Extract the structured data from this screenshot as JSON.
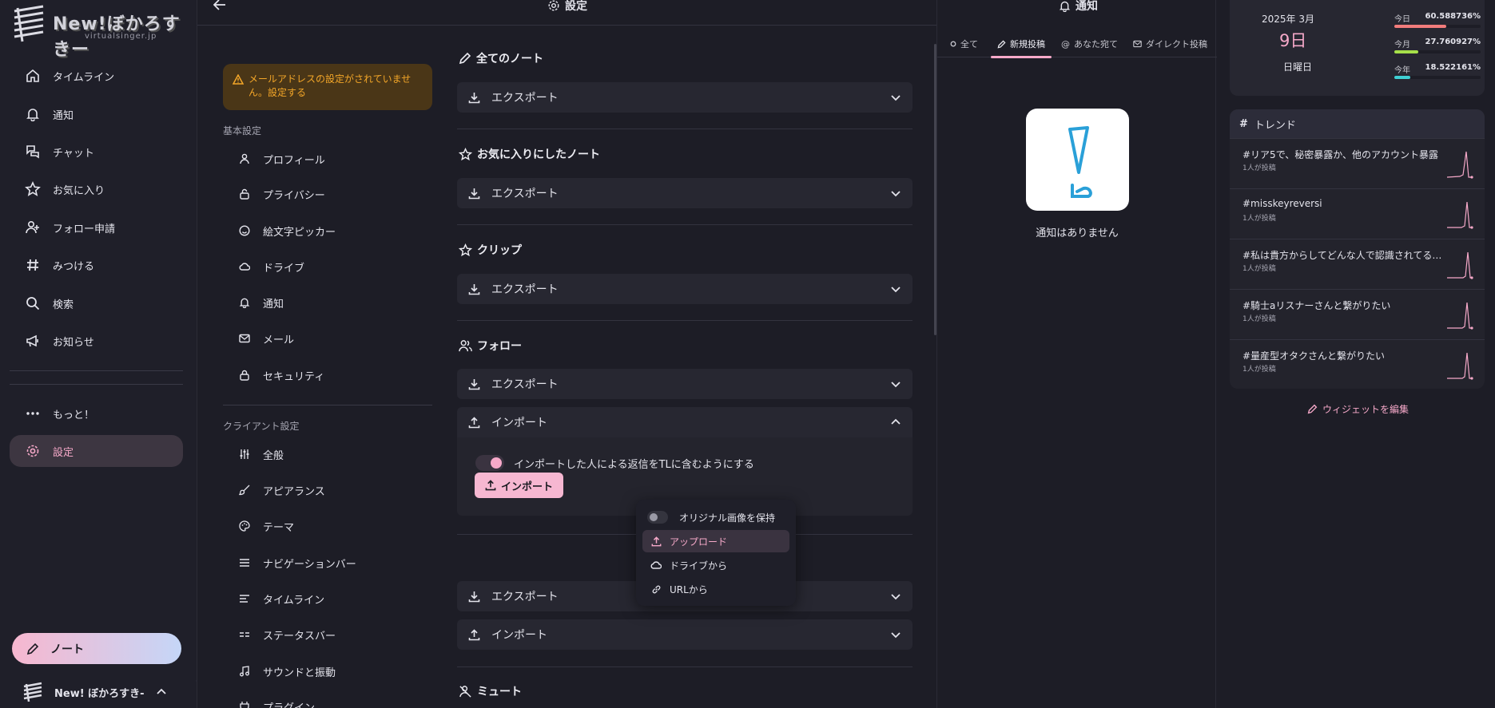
{
  "nav": {
    "logo_title": "New!ぼかろすきー",
    "logo_sub": "virtualsinger.jp",
    "items": [
      {
        "label": "タイムライン",
        "icon": "home-icon"
      },
      {
        "label": "通知",
        "icon": "bell-icon"
      },
      {
        "label": "チャット",
        "icon": "chat-icon"
      },
      {
        "label": "お気に入り",
        "icon": "star-icon"
      },
      {
        "label": "フォロー申請",
        "icon": "user-plus-icon"
      },
      {
        "label": "みつける",
        "icon": "hash-icon"
      },
      {
        "label": "検索",
        "icon": "search-icon"
      },
      {
        "label": "お知らせ",
        "icon": "megaphone-icon"
      },
      {
        "label": "もっと！",
        "icon": "dots-icon"
      },
      {
        "label": "設定",
        "icon": "gear-icon",
        "active": true
      }
    ],
    "note_button": "ノート",
    "account_name": "New! ぼかろすき-"
  },
  "settings": {
    "title": "設定",
    "warning": "メールアドレスの設定がされていません。設定する",
    "basic_label": "基本設定",
    "basic_items": [
      "プロフィール",
      "プライバシー",
      "絵文字ピッカー",
      "ドライブ",
      "通知",
      "メール",
      "セキュリティ"
    ],
    "client_label": "クライアント設定",
    "client_items": [
      "全般",
      "アピアランス",
      "テーマ",
      "ナビゲーションバー",
      "タイムライン",
      "ステータスバー",
      "サウンドと振動",
      "プラグイン"
    ],
    "groups": {
      "all_notes": "全てのノート",
      "favorites": "お気に入りにしたノート",
      "clips": "クリップ",
      "follow": "フォロー",
      "mute": "ミュート"
    },
    "export_label": "エクスポート",
    "import_label": "インポート",
    "toggle_label": "インポートした人による返信をTLに含むようにする",
    "import_button": "インポート"
  },
  "popup": {
    "keep_original": "オリジナル画像を保持",
    "upload": "アップロード",
    "from_drive": "ドライブから",
    "from_url": "URLから"
  },
  "notifications": {
    "title": "通知",
    "tabs": [
      "全て",
      "新規投稿",
      "あなた宛て",
      "ダイレクト投稿"
    ],
    "active_tab": "新規投稿",
    "empty": "通知はありません"
  },
  "calendar": {
    "year_month": "2025年  3月",
    "day": "9日",
    "weekday": "日曜日",
    "stats": [
      {
        "label": "今日",
        "value": "60.588736%",
        "fraction": 0.606,
        "color": "#f27c7c"
      },
      {
        "label": "今月",
        "value": "27.760927%",
        "fraction": 0.278,
        "color": "#a6e04a"
      },
      {
        "label": "今年",
        "value": "18.522161%",
        "fraction": 0.185,
        "color": "#3fd0d4"
      }
    ]
  },
  "trends": {
    "title": "トレンド",
    "items": [
      {
        "tag": "#リア5で、秘密暴露か、他のアカウント暴露",
        "count": "1人が投稿"
      },
      {
        "tag": "#misskeyreversi",
        "count": "1人が投稿"
      },
      {
        "tag": "#私は貴方からしてどんな人で認識されてるのか知りたい",
        "count": "1人が投稿"
      },
      {
        "tag": "#騎士aリスナーさんと繋がりたい",
        "count": "1人が投稿"
      },
      {
        "tag": "#量産型オタクさんと繋がりたい",
        "count": "1人が投稿"
      }
    ],
    "edit_label": "ウィジェットを編集"
  },
  "colors": {
    "accent": "#f6a9c9",
    "warning": "#f3a628",
    "background": "#1d1d26"
  }
}
